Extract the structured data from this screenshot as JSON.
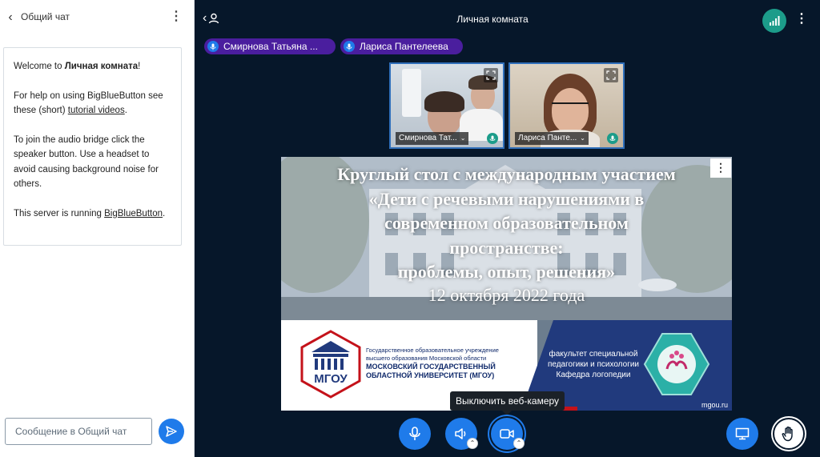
{
  "chat": {
    "title": "Общий чат",
    "welcome": {
      "p1_prefix": "Welcome to ",
      "p1_room": "Личная комната",
      "p1_suffix": "!",
      "p2_text": "For help on using BigBlueButton see these (short) ",
      "p2_link": "tutorial videos",
      "p2_end": ".",
      "p3_text": "To join the audio bridge click the speaker button. Use a headset to avoid causing background noise for others.",
      "p4_text": "This server is running ",
      "p4_link": "BigBlueButton",
      "p4_end": "."
    },
    "input_placeholder": "Сообщение в Общий чат"
  },
  "header": {
    "room_title": "Личная комната"
  },
  "talkers": [
    {
      "name": "Смирнова Татьяна ..."
    },
    {
      "name": "Лариса Пантелеева"
    }
  ],
  "videos": [
    {
      "name": "Смирнова Тат..."
    },
    {
      "name": "Лариса Панте..."
    }
  ],
  "slide": {
    "line1": "Круглый стол с международным участием",
    "line2": "«Дети с речевыми нарушениями в",
    "line3": "современном образовательном",
    "line4": "пространстве:",
    "line5": "проблемы, опыт, решения»",
    "date": "12 октября 2022 года",
    "uni_line1": "Государственное образовательное учреждение",
    "uni_line2": "высшего образования Московской области",
    "uni_line3": "МОСКОВСКИЙ ГОСУДАРСТВЕННЫЙ",
    "uni_line4": "ОБЛАСТНОЙ УНИВЕРСИТЕТ (МГОУ)",
    "logo_text": "МГОУ",
    "faculty_line1": "факультет специальной",
    "faculty_line2": "педагогики и психологии",
    "faculty_line3": "Кафедра логопедии",
    "url": "mgou.ru"
  },
  "tooltip": {
    "text": "Выключить веб-камеру"
  },
  "colors": {
    "accent": "#1f7bea",
    "background": "#06172a",
    "talker_bg": "#4a1e9e",
    "connection": "#1c9c8a"
  }
}
